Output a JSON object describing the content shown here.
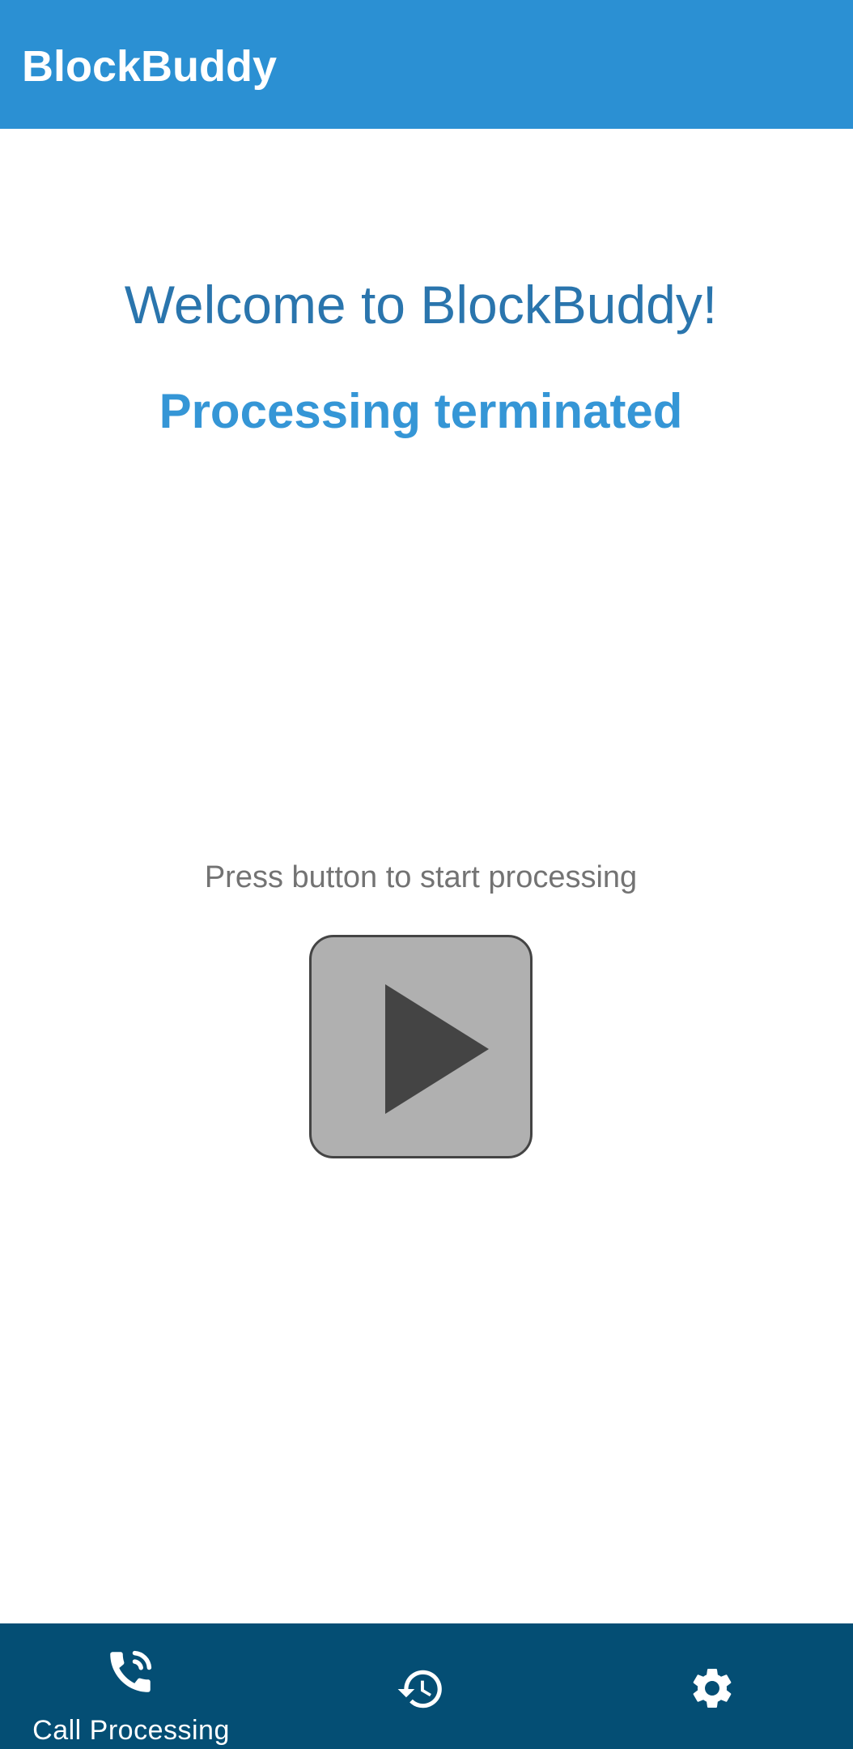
{
  "app_bar": {
    "title": "BlockBuddy",
    "background_color": "#2b90d3"
  },
  "main": {
    "welcome_text": "Welcome to BlockBuddy!",
    "status_text": "Processing terminated",
    "prompt_text": "Press button to start processing",
    "start_button": {
      "icon": "play-icon",
      "background_color": "#b0b0b0",
      "icon_color": "#444444"
    },
    "colors": {
      "welcome": "#2a75ad",
      "status": "#3596d6",
      "prompt": "#737373"
    }
  },
  "bottom_nav": {
    "background_color": "#044e74",
    "items": [
      {
        "label": "Call Processing",
        "icon": "phone-call-icon",
        "selected": true
      },
      {
        "label": "",
        "icon": "history-icon",
        "selected": false
      },
      {
        "label": "",
        "icon": "gear-icon",
        "selected": false
      }
    ]
  }
}
